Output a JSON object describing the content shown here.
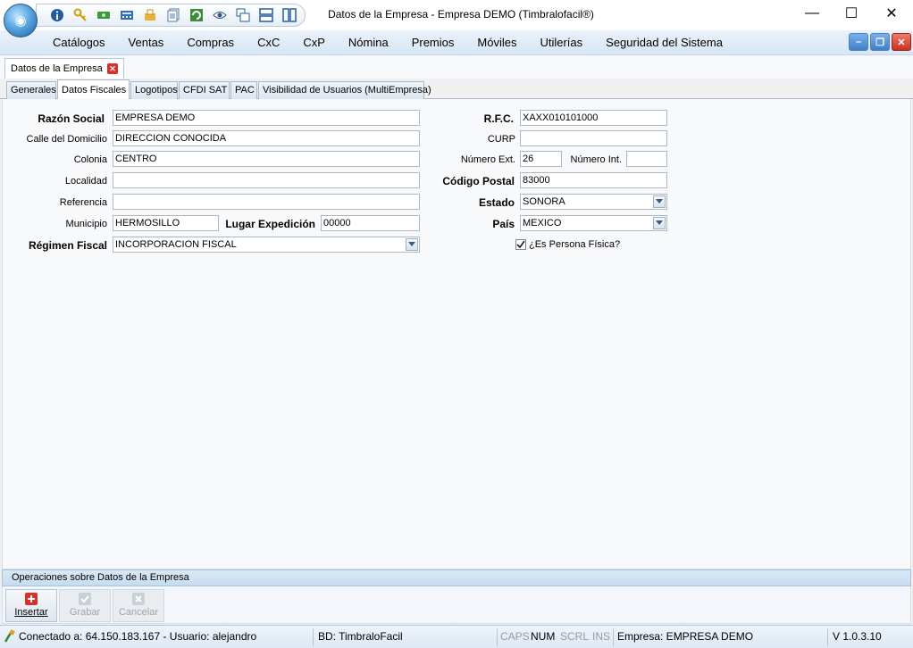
{
  "window": {
    "title": "Datos de la Empresa - Empresa DEMO (Timbralofacil®)",
    "minimize": "—",
    "maximize": "☐",
    "close": "✕",
    "app_icon": "globe-icon",
    "quick_access_icons": [
      "info-icon",
      "key-icon",
      "money-icon",
      "calculator-icon",
      "inbox-icon",
      "documents-icon",
      "refresh-icon",
      "eye-icon",
      "windows-cascade-icon",
      "split-horizontal-icon",
      "split-vertical-icon"
    ]
  },
  "menu": {
    "items": [
      "Catálogos",
      "Ventas",
      "Compras",
      "CxC",
      "CxP",
      "Nómina",
      "Premios",
      "Móviles",
      "Utilerías",
      "Seguridad del Sistema"
    ]
  },
  "mdi_buttons": {
    "minimize": "–",
    "restore": "❐",
    "close": "✕"
  },
  "doc_tab": {
    "label": "Datos de la Empresa"
  },
  "tabs": [
    "Generales",
    "Datos Fiscales",
    "Logotipos",
    "CFDI SAT",
    "PAC",
    "Visibilidad de Usuarios (MultiEmpresa)"
  ],
  "active_tab": "Datos Fiscales",
  "form": {
    "razon_social": {
      "label": "Razón Social",
      "value": "EMPRESA DEMO"
    },
    "calle": {
      "label": "Calle del Domicilio",
      "value": "DIRECCION CONOCIDA"
    },
    "colonia": {
      "label": "Colonia",
      "value": "CENTRO"
    },
    "localidad": {
      "label": "Localidad",
      "value": ""
    },
    "referencia": {
      "label": "Referencia",
      "value": ""
    },
    "municipio": {
      "label": "Municipio",
      "value": "HERMOSILLO"
    },
    "lugar_expedicion": {
      "label": "Lugar Expedición",
      "value": "00000"
    },
    "regimen_fiscal": {
      "label": "Régimen Fiscal",
      "value": "INCORPORACION FISCAL"
    },
    "rfc": {
      "label": "R.F.C.",
      "value": "XAXX010101000"
    },
    "curp": {
      "label": "CURP",
      "value": ""
    },
    "numero_ext": {
      "label": "Número Ext.",
      "value": "26"
    },
    "numero_int": {
      "label": "Número Int.",
      "value": ""
    },
    "codigo_postal": {
      "label": "Código Postal",
      "value": "83000"
    },
    "estado": {
      "label": "Estado",
      "value": "SONORA"
    },
    "pais": {
      "label": "País",
      "value": "MEXICO"
    },
    "persona_fisica": {
      "label": "¿Es Persona Física?",
      "checked": true
    }
  },
  "operations": {
    "title": "Operaciones sobre Datos de la Empresa",
    "insertar": "Insertar",
    "grabar": "Grabar",
    "cancelar": "Cancelar"
  },
  "status": {
    "connection": "Conectado a: 64.150.183.167 - Usuario: alejandro",
    "db": "BD: TimbraloFacil",
    "caps": "CAPS",
    "num": "NUM",
    "scrl": "SCRL",
    "ins": "INS",
    "empresa": "Empresa: EMPRESA DEMO",
    "version": "V 1.0.3.10"
  }
}
